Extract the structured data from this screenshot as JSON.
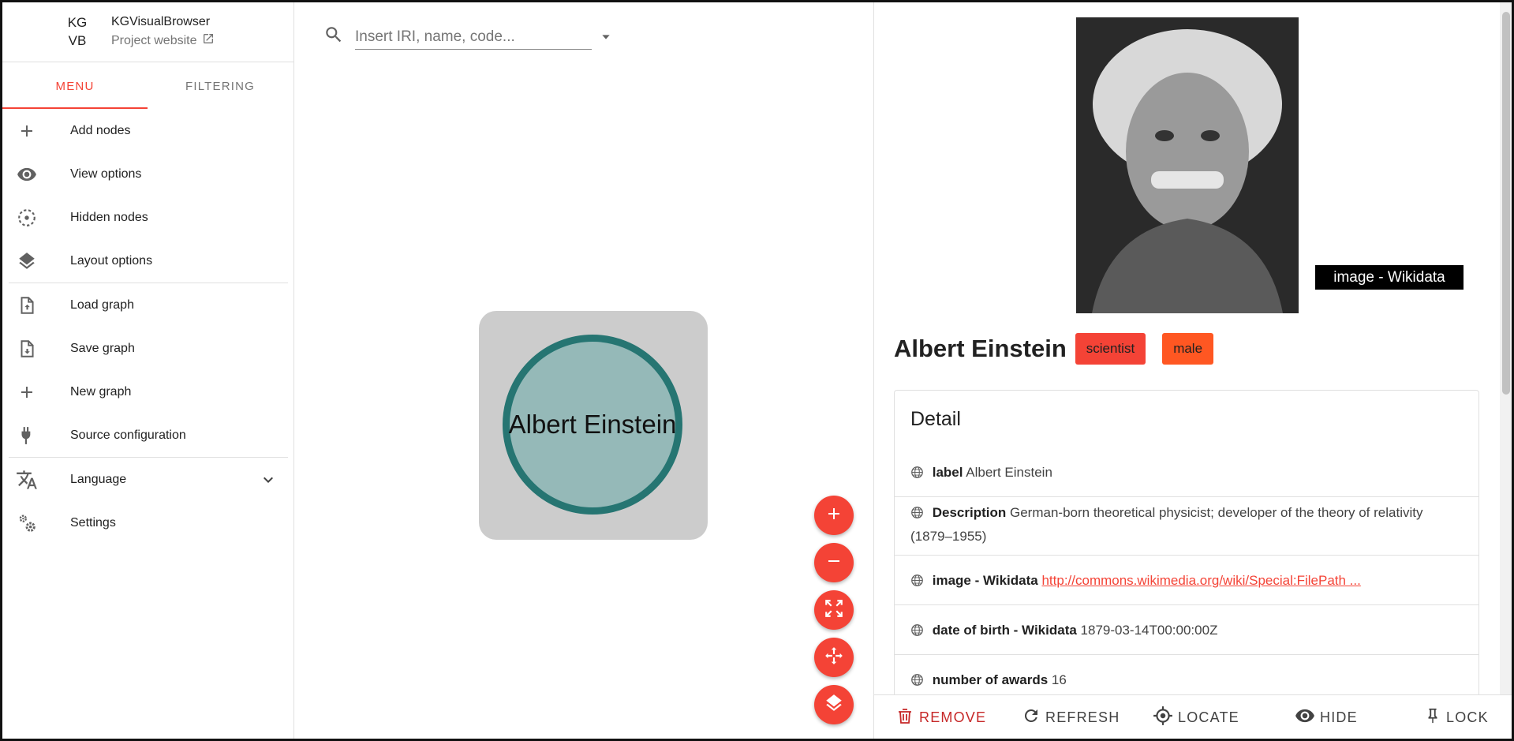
{
  "brand": {
    "logo_line1": "KG",
    "logo_line2": "VB",
    "title": "KGVisualBrowser",
    "project_link": "Project website"
  },
  "tabs": [
    "MENU",
    "FILTERING"
  ],
  "menu": {
    "add_nodes": "Add nodes",
    "view_options": "View options",
    "hidden_nodes": "Hidden nodes",
    "layout_options": "Layout options",
    "load_graph": "Load graph",
    "save_graph": "Save graph",
    "new_graph": "New graph",
    "source_configuration": "Source configuration",
    "language": "Language",
    "settings": "Settings"
  },
  "search": {
    "placeholder": "Insert IRI, name, code..."
  },
  "graph": {
    "node_label": "Albert Einstein"
  },
  "panel": {
    "image_caption": "image - Wikidata",
    "title": "Albert Einstein",
    "chips": [
      "scientist",
      "male"
    ],
    "detail_heading": "Detail",
    "properties": [
      {
        "key": "label",
        "value": "Albert Einstein"
      },
      {
        "key": "Description",
        "value": "German-born theoretical physicist; developer of the theory of relativity (1879–1955)"
      },
      {
        "key": "image - Wikidata",
        "value": "http://commons.wikimedia.org/wiki/Special:FilePath ..."
      },
      {
        "key": "date of birth - Wikidata",
        "value": "1879-03-14T00:00:00Z"
      },
      {
        "key": "number of awards",
        "value": "16"
      }
    ]
  },
  "actions": {
    "remove": "REMOVE",
    "refresh": "REFRESH",
    "locate": "LOCATE",
    "hide": "HIDE",
    "lock": "LOCK"
  },
  "colors": {
    "accent": "#f44336",
    "chip_male": "#ff5722",
    "node_fill": "#95b9b8",
    "node_border": "#267572",
    "node_background": "#cccccc"
  }
}
